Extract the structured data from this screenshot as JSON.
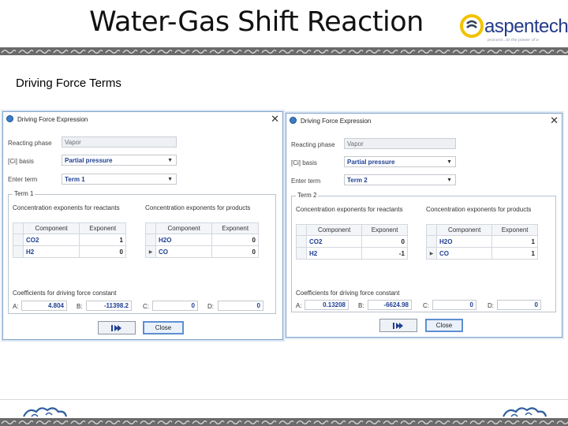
{
  "slide": {
    "title": "Water-Gas Shift Reaction",
    "subtitle": "Driving Force Terms",
    "logo": {
      "word": "aspentech",
      "tagline": "process...to the power of e"
    }
  },
  "dialogs": [
    {
      "window_title": "Driving Force Expression",
      "reacting_phase_label": "Reacting phase",
      "reacting_phase_value": "Vapor",
      "basis_label": "[Ci] basis",
      "basis_value": "Partial pressure",
      "enter_term_label": "Enter term",
      "enter_term_value": "Term 1",
      "term_group": "Term 1",
      "reactants_label": "Concentration exponents for reactants",
      "products_label": "Concentration exponents for products",
      "reactant_headers": [
        "Component",
        "Exponent"
      ],
      "reactants": [
        {
          "component": "CO2",
          "exponent": "1"
        },
        {
          "component": "H2",
          "exponent": "0"
        }
      ],
      "product_headers": [
        "Component",
        "Exponent"
      ],
      "products": [
        {
          "component": "H2O",
          "exponent": "0"
        },
        {
          "component": "CO",
          "exponent": "0"
        }
      ],
      "coef_label": "Coefficients for driving force constant",
      "coefficients": {
        "A": {
          "label": "A:",
          "value": "4.804"
        },
        "B": {
          "label": "B:",
          "value": "-11398.2"
        },
        "C": {
          "label": "C:",
          "value": "0"
        },
        "D": {
          "label": "D:",
          "value": "0"
        }
      },
      "close_label": "Close"
    },
    {
      "window_title": "Driving Force Expression",
      "reacting_phase_label": "Reacting phase",
      "reacting_phase_value": "Vapor",
      "basis_label": "[Ci] basis",
      "basis_value": "Partial pressure",
      "enter_term_label": "Enter term",
      "enter_term_value": "Term 2",
      "term_group": "Term 2",
      "reactants_label": "Concentration exponents for reactants",
      "products_label": "Concentration exponents for products",
      "reactant_headers": [
        "Component",
        "Exponent"
      ],
      "reactants": [
        {
          "component": "CO2",
          "exponent": "0"
        },
        {
          "component": "H2",
          "exponent": "-1"
        }
      ],
      "product_headers": [
        "Component",
        "Exponent"
      ],
      "products": [
        {
          "component": "H2O",
          "exponent": "1"
        },
        {
          "component": "CO",
          "exponent": "1"
        }
      ],
      "coef_label": "Coefficients for driving force constant",
      "coefficients": {
        "A": {
          "label": "A:",
          "value": "0.13208"
        },
        "B": {
          "label": "B:",
          "value": "-6624.98"
        },
        "C": {
          "label": "C:",
          "value": "0"
        },
        "D": {
          "label": "D:",
          "value": "0"
        }
      },
      "close_label": "Close"
    }
  ],
  "icons": {
    "next": "next-arrow-icon",
    "close": "close-icon",
    "dropdown": "chevron-down-icon",
    "row_pointer": "row-pointer-icon"
  },
  "colors": {
    "band": "#6a6a6a",
    "logo_blue": "#233a8a",
    "logo_yellow": "#f2c200",
    "value_blue": "#1f3f93",
    "dialog_border": "#7fa3cc"
  }
}
